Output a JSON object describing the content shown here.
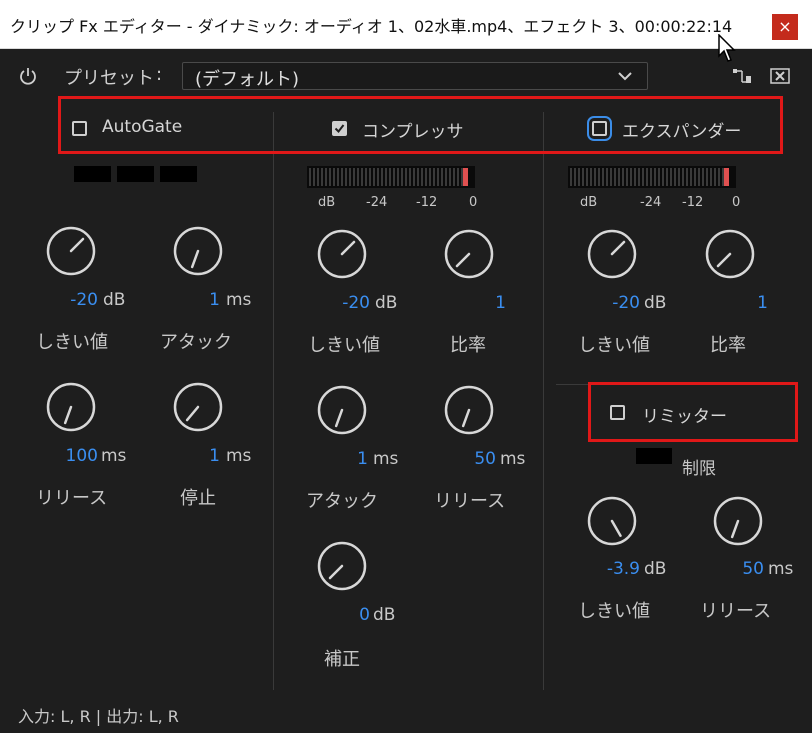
{
  "window": {
    "title": "クリップ Fx エディター - ダイナミック: オーディオ 1、02水車.mp4、エフェクト 3、00:00:22:14",
    "close_glyph": "×"
  },
  "toolbar": {
    "preset_label": "プリセット",
    "preset_colon": ":",
    "preset_value": "(デフォルト)"
  },
  "autogate": {
    "label": "AutoGate",
    "checked": false,
    "threshold": {
      "value": "-20",
      "unit": "dB",
      "name": "しきい値"
    },
    "attack": {
      "value": "1",
      "unit": "ms",
      "name": "アタック"
    },
    "release": {
      "value": "100",
      "unit": "ms",
      "name": "リリース"
    },
    "hold": {
      "value": "1",
      "unit": "ms",
      "name": "停止"
    }
  },
  "compressor": {
    "label": "コンプレッサ",
    "checked": true,
    "meter": {
      "labels": [
        "dB",
        "-24",
        "-12",
        "0"
      ]
    },
    "threshold": {
      "value": "-20",
      "unit": "dB",
      "name": "しきい値"
    },
    "ratio": {
      "value": "1",
      "name": "比率"
    },
    "attack": {
      "value": "1",
      "unit": "ms",
      "name": "アタック"
    },
    "release": {
      "value": "50",
      "unit": "ms",
      "name": "リリース"
    },
    "makeup": {
      "value": "0",
      "unit": "dB",
      "name": "補正"
    }
  },
  "expander": {
    "label": "エクスパンダー",
    "checked": false,
    "meter": {
      "labels": [
        "dB",
        "-24",
        "-12",
        "0"
      ]
    },
    "threshold": {
      "value": "-20",
      "unit": "dB",
      "name": "しきい値"
    },
    "ratio": {
      "value": "1",
      "name": "比率"
    }
  },
  "limiter": {
    "label": "リミッター",
    "checked": false,
    "limit_label": "制限",
    "threshold": {
      "value": "-3.9",
      "unit": "dB",
      "name": "しきい値"
    },
    "release": {
      "value": "50",
      "unit": "ms",
      "name": "リリース"
    }
  },
  "status": {
    "text": "入力: L, R | 出力: L, R"
  },
  "colors": {
    "accent_value": "#3a8ef0",
    "highlight_box": "#e01818",
    "close_button": "#c42b1c"
  }
}
